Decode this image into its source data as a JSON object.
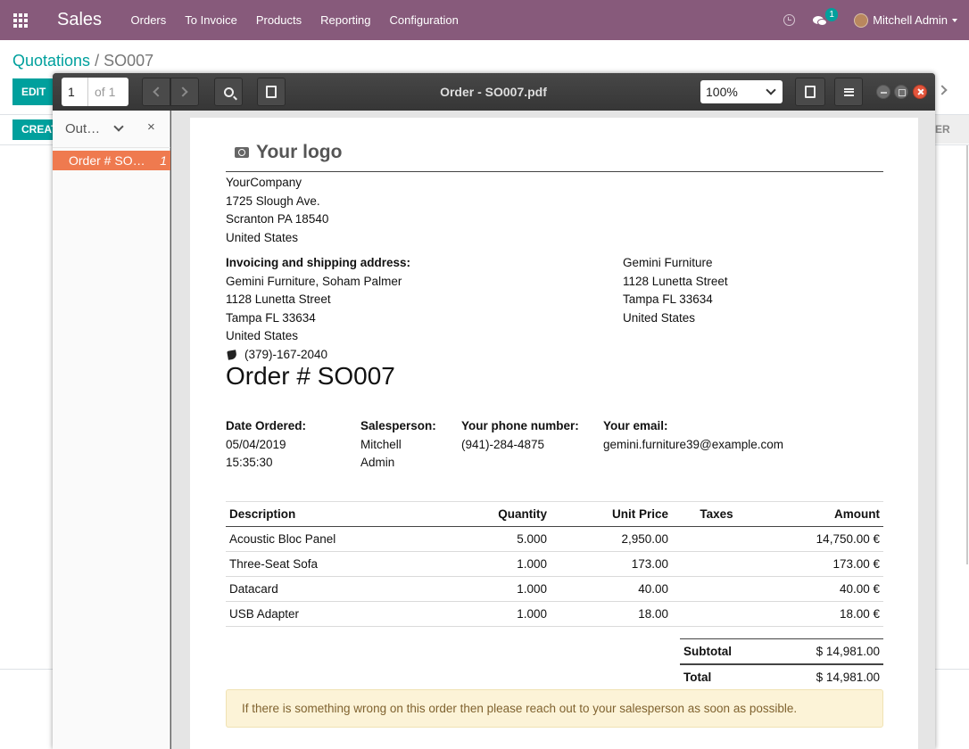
{
  "navbar": {
    "brand": "Sales",
    "menu": [
      "Orders",
      "To Invoice",
      "Products",
      "Reporting",
      "Configuration"
    ],
    "chat_badge": "1",
    "user": "Mitchell Admin",
    "bg_color": "#875a7b"
  },
  "control_panel": {
    "breadcrumb_parent": "Quotations",
    "breadcrumb_current": "SO007",
    "edit_label": "EDIT",
    "create_label": "CREATE",
    "right_status_label": "ER"
  },
  "pdf_viewer": {
    "page_number": "1",
    "page_of": "of 1",
    "title": "Order - SO007.pdf",
    "zoom": "100%",
    "sidebar_title": "Out…",
    "sidebar_close": "×",
    "outline_item": "Order # SO…",
    "outline_item_page": "1"
  },
  "document": {
    "logo_text": "Your logo",
    "company": [
      "YourCompany",
      "1725 Slough Ave.",
      "Scranton PA 18540",
      "United States"
    ],
    "invoicing_label": "Invoicing and shipping address:",
    "invoicing": [
      "Gemini Furniture, Soham Palmer",
      "1128 Lunetta Street",
      "Tampa FL 33634",
      "United States"
    ],
    "phone": "(379)-167-2040",
    "partner": [
      "Gemini Furniture",
      "1128 Lunetta Street",
      "Tampa FL 33634",
      "United States"
    ],
    "order_title": "Order # SO007",
    "info": {
      "date_label": "Date Ordered:",
      "date_line1": "05/04/2019",
      "date_line2": "15:35:30",
      "sales_label": "Salesperson:",
      "sales_line1": "Mitchell",
      "sales_line2": "Admin",
      "phone_label": "Your phone number:",
      "phone_value": "(941)-284-4875",
      "email_label": "Your email:",
      "email_value": "gemini.furniture39@example.com"
    },
    "table_headers": [
      "Description",
      "Quantity",
      "Unit Price",
      "Taxes",
      "Amount"
    ],
    "lines": [
      {
        "desc": "Acoustic Bloc Panel",
        "qty": "5.000",
        "price": "2,950.00",
        "taxes": "",
        "amount": "14,750.00 €"
      },
      {
        "desc": "Three-Seat Sofa",
        "qty": "1.000",
        "price": "173.00",
        "taxes": "",
        "amount": "173.00 €"
      },
      {
        "desc": "Datacard",
        "qty": "1.000",
        "price": "40.00",
        "taxes": "",
        "amount": "40.00 €"
      },
      {
        "desc": "USB Adapter",
        "qty": "1.000",
        "price": "18.00",
        "taxes": "",
        "amount": "18.00 €"
      }
    ],
    "subtotal_label": "Subtotal",
    "subtotal_value": "$ 14,981.00",
    "total_label": "Total",
    "total_value": "$ 14,981.00",
    "note": "If there is something wrong on this order then please reach out to your salesperson as soon as possible."
  }
}
